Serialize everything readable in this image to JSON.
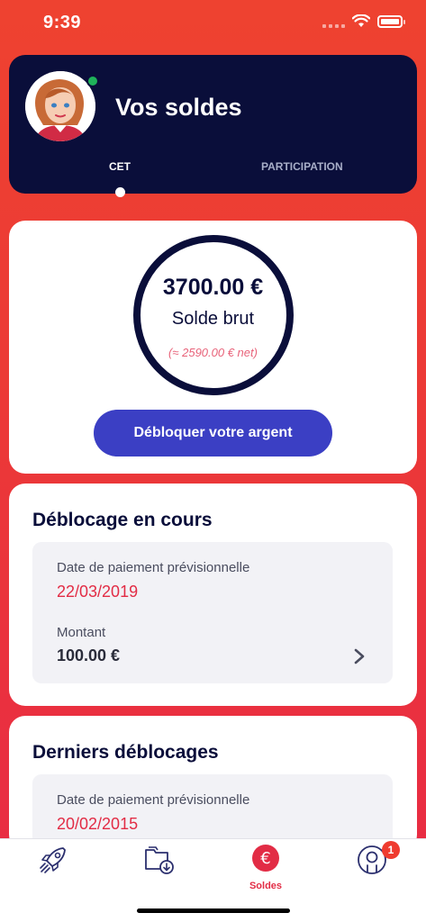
{
  "status_bar": {
    "time": "9:39"
  },
  "header": {
    "title": "Vos soldes",
    "tabs": [
      {
        "label": "CET",
        "active": true
      },
      {
        "label": "PARTICIPATION",
        "active": false
      }
    ]
  },
  "balance": {
    "amount": "3700.00 €",
    "label": "Solde brut",
    "net": "(≈ 2590.00 € net)",
    "button_label": "Débloquer votre argent"
  },
  "pending": {
    "title": "Déblocage en cours",
    "date_label": "Date de paiement prévisionnelle",
    "date_value": "22/03/2019",
    "amount_label": "Montant",
    "amount_value": "100.00 €"
  },
  "history": {
    "title": "Derniers déblocages",
    "date_label": "Date de paiement prévisionnelle",
    "date_value": "20/02/2015"
  },
  "tab_bar": {
    "items": [
      {
        "icon": "rocket-icon",
        "label": ""
      },
      {
        "icon": "folder-download-icon",
        "label": ""
      },
      {
        "icon": "euro-icon",
        "label": "Soldes",
        "active": true
      },
      {
        "icon": "profile-icon",
        "label": ""
      }
    ],
    "badge_count": "1"
  },
  "colors": {
    "accent_red": "#e22c45",
    "navy": "#0a0e3a",
    "button_blue": "#3b3fc4"
  }
}
